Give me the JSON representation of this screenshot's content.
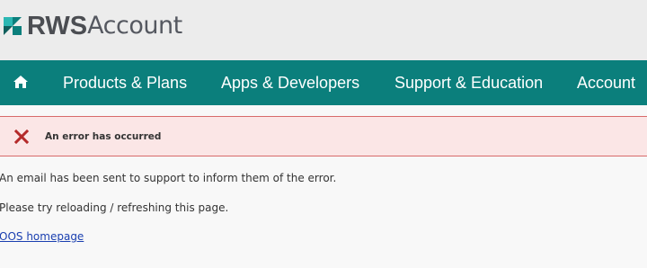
{
  "brand": {
    "logo_bold": "RWS",
    "logo_light": "Account",
    "mark_colors": [
      "#0b7f7c",
      "#2bb7b3",
      "#0f5e5c"
    ]
  },
  "nav": {
    "home_icon": "home-icon",
    "items": [
      {
        "label": "Products & Plans"
      },
      {
        "label": "Apps & Developers"
      },
      {
        "label": "Support & Education"
      },
      {
        "label": "Account"
      }
    ],
    "background": "#0b7f7c"
  },
  "alert": {
    "icon": "close-x-icon",
    "message": "An error has occurred",
    "background": "#fbe6e6",
    "icon_color": "#b42a2a"
  },
  "content": {
    "line1": "An email has been sent to support to inform them of the error.",
    "line2": "Please try reloading / refreshing this page.",
    "link_text": "OOS homepage"
  }
}
